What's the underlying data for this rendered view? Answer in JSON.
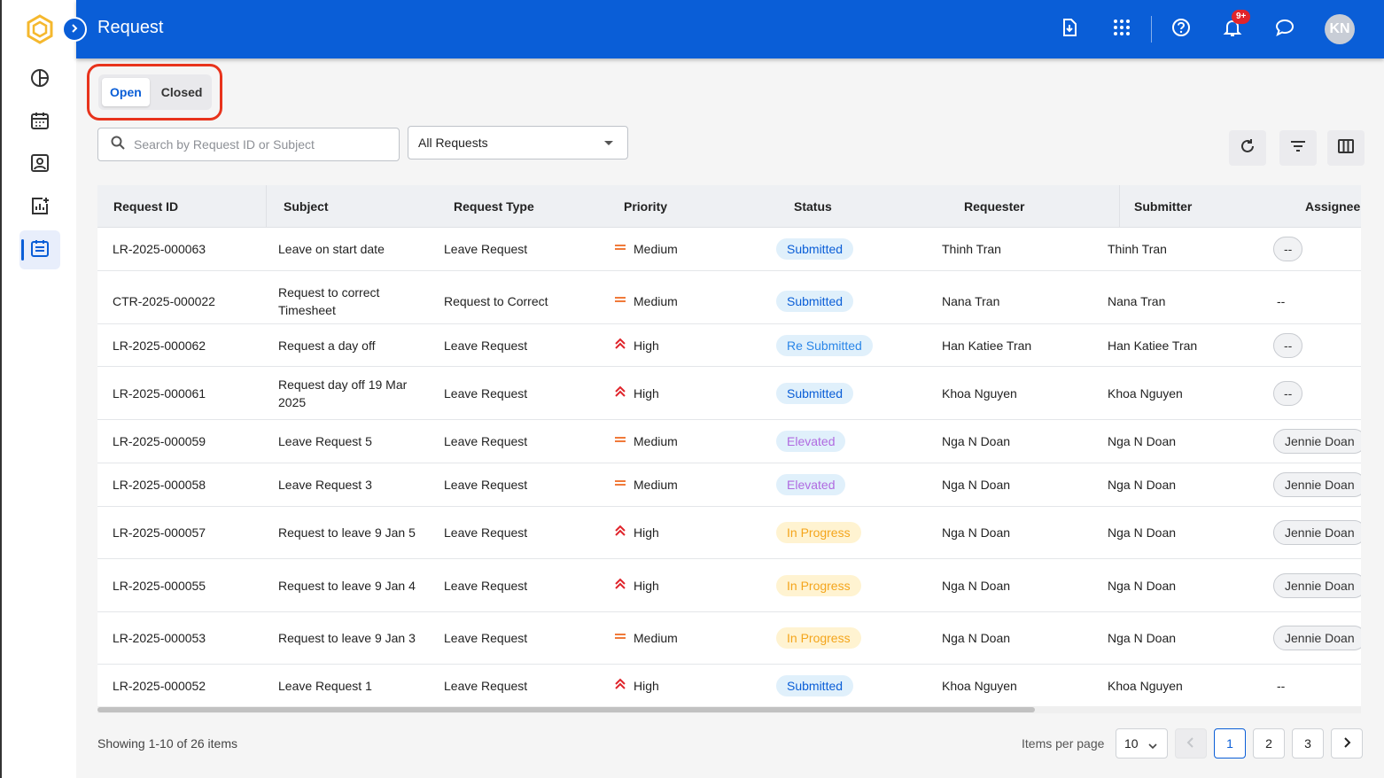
{
  "header": {
    "title": "Request",
    "notification_badge": "9+",
    "avatar_initials": "KN",
    "icons": [
      "download-file-icon",
      "apps-grid-icon",
      "help-icon",
      "bell-icon",
      "chat-icon"
    ]
  },
  "sidebar": {
    "items": [
      "dashboard-icon",
      "calendar-icon",
      "profile-icon",
      "analytics-icon",
      "requests-icon"
    ],
    "active": "requests-icon"
  },
  "tabs": [
    {
      "label": "Open",
      "active": true
    },
    {
      "label": "Closed",
      "active": false
    }
  ],
  "search": {
    "placeholder": "Search by Request ID or Subject",
    "value": ""
  },
  "filter_select": {
    "value": "All Requests"
  },
  "table": {
    "columns": [
      "Request ID",
      "Subject",
      "Request Type",
      "Priority",
      "Status",
      "Requester",
      "Submitter",
      "Assignee"
    ],
    "rows": [
      {
        "id": "LR-2025-000063",
        "subject": "Leave on start date",
        "type": "Leave Request",
        "priority": "Medium",
        "status": "Submitted",
        "requester": "Thinh Tran",
        "submitter": "Thinh Tran",
        "assignee": "--",
        "assignee_chip": true
      },
      {
        "id": "CTR-2025-000022",
        "subject": "Request to correct Timesheet",
        "type": "Request to Correct",
        "priority": "Medium",
        "status": "Submitted",
        "requester": "Nana Tran",
        "submitter": "Nana Tran",
        "assignee": "--",
        "assignee_chip": false
      },
      {
        "id": "LR-2025-000062",
        "subject": "Request a day off",
        "type": "Leave Request",
        "priority": "High",
        "status": "Re Submitted",
        "requester": "Han Katiee Tran",
        "submitter": "Han Katiee Tran",
        "assignee": "--",
        "assignee_chip": true
      },
      {
        "id": "LR-2025-000061",
        "subject": "Request day off 19 Mar 2025",
        "type": "Leave Request",
        "priority": "High",
        "status": "Submitted",
        "requester": "Khoa Nguyen",
        "submitter": "Khoa Nguyen",
        "assignee": "--",
        "assignee_chip": true
      },
      {
        "id": "LR-2025-000059",
        "subject": "Leave Request 5",
        "type": "Leave Request",
        "priority": "Medium",
        "status": "Elevated",
        "requester": "Nga N Doan",
        "submitter": "Nga N Doan",
        "assignee": "Jennie Doan",
        "assignee_chip": true
      },
      {
        "id": "LR-2025-000058",
        "subject": "Leave Request 3",
        "type": "Leave Request",
        "priority": "Medium",
        "status": "Elevated",
        "requester": "Nga N Doan",
        "submitter": "Nga N Doan",
        "assignee": "Jennie Doan",
        "assignee_chip": true
      },
      {
        "id": "LR-2025-000057",
        "subject": "Request to leave 9 Jan 5",
        "type": "Leave Request",
        "priority": "High",
        "status": "In Progress",
        "requester": "Nga N Doan",
        "submitter": "Nga N Doan",
        "assignee": "Jennie Doan",
        "assignee_chip": true
      },
      {
        "id": "LR-2025-000055",
        "subject": "Request to leave 9 Jan 4",
        "type": "Leave Request",
        "priority": "High",
        "status": "In Progress",
        "requester": "Nga N Doan",
        "submitter": "Nga N Doan",
        "assignee": "Jennie Doan",
        "assignee_chip": true
      },
      {
        "id": "LR-2025-000053",
        "subject": "Request to leave 9 Jan 3",
        "type": "Leave Request",
        "priority": "Medium",
        "status": "In Progress",
        "requester": "Nga N Doan",
        "submitter": "Nga N Doan",
        "assignee": "Jennie Doan",
        "assignee_chip": true
      },
      {
        "id": "LR-2025-000052",
        "subject": "Leave Request 1",
        "type": "Leave Request",
        "priority": "High",
        "status": "Submitted",
        "requester": "Khoa Nguyen",
        "submitter": "Khoa Nguyen",
        "assignee": "--",
        "assignee_chip": false
      }
    ]
  },
  "footer": {
    "showing": "Showing 1-10 of 26 items",
    "items_per_page_label": "Items per page",
    "items_per_page": "10",
    "pages": [
      "1",
      "2",
      "3"
    ],
    "current_page": "1"
  },
  "colors": {
    "brand": "#0a5ed7",
    "priority_medium": "#f07a3a",
    "priority_high": "#e0242b"
  }
}
